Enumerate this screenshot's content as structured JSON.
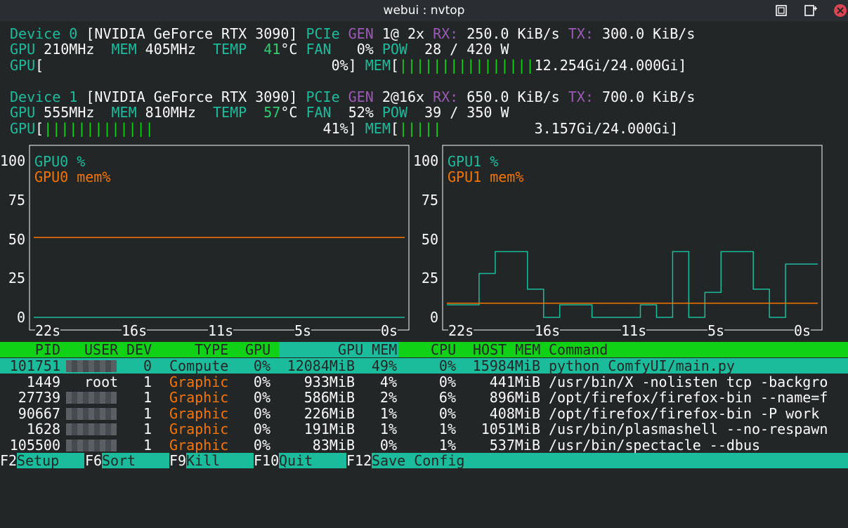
{
  "window": {
    "title": "webui : nvtop",
    "icons": [
      "maximize-icon",
      "pin-icon",
      "close-icon"
    ]
  },
  "devices": [
    {
      "line1": [
        {
          "text": "Device 0 ",
          "c": "t"
        },
        {
          "text": "[NVIDIA GeForce RTX 3090] ",
          "c": "w"
        },
        {
          "text": "PCIe ",
          "c": "t"
        },
        {
          "text": "GEN ",
          "c": "p"
        },
        {
          "text": "1@ 2x ",
          "c": "w"
        },
        {
          "text": "RX: ",
          "c": "p"
        },
        {
          "text": "250.0 KiB/s ",
          "c": "w"
        },
        {
          "text": "TX: ",
          "c": "p"
        },
        {
          "text": "300.0 KiB/s",
          "c": "w"
        }
      ],
      "line2": [
        {
          "text": "GPU ",
          "c": "t"
        },
        {
          "text": "210MHz  ",
          "c": "w"
        },
        {
          "text": "MEM ",
          "c": "t"
        },
        {
          "text": "405MHz  ",
          "c": "w"
        },
        {
          "text": "TEMP  ",
          "c": "t"
        },
        {
          "text": "41",
          "c": "g"
        },
        {
          "text": "°C ",
          "c": "w"
        },
        {
          "text": "FAN   ",
          "c": "t"
        },
        {
          "text": "0% ",
          "c": "w"
        },
        {
          "text": "POW  ",
          "c": "t"
        },
        {
          "text": "28 / 420 W",
          "c": "w"
        }
      ],
      "line3": [
        {
          "text": "GPU",
          "c": "t"
        },
        {
          "text": "[",
          "c": "w"
        },
        {
          "text": "",
          "c": "bar"
        },
        {
          "text": "                                  0%",
          "c": "w"
        },
        {
          "text": "] ",
          "c": "w"
        },
        {
          "text": "MEM",
          "c": "t"
        },
        {
          "text": "[",
          "c": "w"
        },
        {
          "text": "||||||||||||||||",
          "c": "bar"
        },
        {
          "text": "12.254Gi/24.000Gi",
          "c": "w"
        },
        {
          "text": "]",
          "c": "w"
        }
      ]
    },
    {
      "line1": [
        {
          "text": "Device 1 ",
          "c": "t"
        },
        {
          "text": "[NVIDIA GeForce RTX 3090] ",
          "c": "w"
        },
        {
          "text": "PCIe ",
          "c": "t"
        },
        {
          "text": "GEN ",
          "c": "p"
        },
        {
          "text": "2@16x ",
          "c": "w"
        },
        {
          "text": "RX: ",
          "c": "p"
        },
        {
          "text": "650.0 KiB/s ",
          "c": "w"
        },
        {
          "text": "TX: ",
          "c": "p"
        },
        {
          "text": "700.0 KiB/s",
          "c": "w"
        }
      ],
      "line2": [
        {
          "text": "GPU ",
          "c": "t"
        },
        {
          "text": "555MHz  ",
          "c": "w"
        },
        {
          "text": "MEM ",
          "c": "t"
        },
        {
          "text": "810MHz  ",
          "c": "w"
        },
        {
          "text": "TEMP  ",
          "c": "t"
        },
        {
          "text": "57",
          "c": "g"
        },
        {
          "text": "°C ",
          "c": "w"
        },
        {
          "text": "FAN  ",
          "c": "t"
        },
        {
          "text": "52% ",
          "c": "w"
        },
        {
          "text": "POW  ",
          "c": "t"
        },
        {
          "text": "39 / 350 W",
          "c": "w"
        }
      ],
      "line3": [
        {
          "text": "GPU",
          "c": "t"
        },
        {
          "text": "[",
          "c": "w"
        },
        {
          "text": "|||||||||||||",
          "c": "bar"
        },
        {
          "text": "                    41%",
          "c": "w"
        },
        {
          "text": "] ",
          "c": "w"
        },
        {
          "text": "MEM",
          "c": "t"
        },
        {
          "text": "[",
          "c": "w"
        },
        {
          "text": "|||||",
          "c": "bar"
        },
        {
          "text": "           3.157Gi/24.000Gi",
          "c": "w"
        },
        {
          "text": "]",
          "c": "w"
        }
      ]
    }
  ],
  "chart_data": [
    {
      "type": "line",
      "legend": [
        "GPU0 %",
        "GPU0 mem%"
      ],
      "yticks": [
        "100",
        "75",
        "50",
        "25",
        "0"
      ],
      "xticks": [
        "22s",
        "16s",
        "11s",
        "5s",
        "0s"
      ],
      "ylim": [
        0,
        100
      ],
      "x": [
        -23,
        -22,
        -21,
        -20,
        -19,
        -18,
        -17,
        -16,
        -15,
        -14,
        -13,
        -12,
        -11,
        -10,
        -9,
        -8,
        -7,
        -6,
        -5,
        -4,
        -3,
        -2,
        -1,
        0
      ],
      "series": [
        {
          "name": "GPU0 %",
          "color": "#1abc9c",
          "values": [
            0,
            0,
            0,
            0,
            0,
            0,
            0,
            0,
            0,
            0,
            0,
            0,
            0,
            0,
            0,
            0,
            0,
            0,
            0,
            0,
            0,
            0,
            0,
            0
          ]
        },
        {
          "name": "GPU0 mem%",
          "color": "#f67400",
          "values": [
            51,
            51,
            51,
            51,
            51,
            51,
            51,
            51,
            51,
            51,
            51,
            51,
            51,
            51,
            51,
            51,
            51,
            51,
            51,
            51,
            51,
            51,
            51,
            51
          ]
        }
      ]
    },
    {
      "type": "line",
      "legend": [
        "GPU1 %",
        "GPU1 mem%"
      ],
      "yticks": [
        "100",
        "75",
        "50",
        "25",
        "0"
      ],
      "xticks": [
        "22s",
        "16s",
        "11s",
        "5s",
        "0s"
      ],
      "ylim": [
        0,
        100
      ],
      "x": [
        -23,
        -22,
        -21,
        -20,
        -19,
        -18,
        -17,
        -16,
        -15,
        -14,
        -13,
        -12,
        -11,
        -10,
        -9,
        -8,
        -7,
        -6,
        -5,
        -4,
        -3,
        -2,
        -1,
        0
      ],
      "series": [
        {
          "name": "GPU1 %",
          "color": "#1abc9c",
          "values": [
            8,
            8,
            28,
            42,
            42,
            18,
            0,
            8,
            8,
            0,
            0,
            0,
            8,
            0,
            42,
            0,
            16,
            42,
            42,
            18,
            0,
            34,
            34,
            34
          ]
        },
        {
          "name": "GPU1 mem%",
          "color": "#f67400",
          "values": [
            9,
            9,
            9,
            9,
            9,
            9,
            9,
            9,
            9,
            9,
            9,
            9,
            9,
            9,
            9,
            9,
            9,
            9,
            9,
            9,
            9,
            9,
            9,
            9
          ]
        }
      ]
    }
  ],
  "process_table": {
    "headers": {
      "pid": "PID",
      "user": "USER",
      "dev": "DEV",
      "type": "TYPE",
      "gpu": "GPU",
      "gpumem": "GPU MEM",
      "cpu": "CPU",
      "hostmem": "HOST MEM",
      "cmd": "Command"
    },
    "rows": [
      {
        "pid": "101751",
        "user": "",
        "dev": "0",
        "type": "Compute",
        "gpu": "0%",
        "gpumem": "12084MiB",
        "mempct": "49%",
        "cpu": "0%",
        "hostmem": "15984MiB",
        "cmd": "python ComfyUI/main.py",
        "selected": true
      },
      {
        "pid": "1449",
        "user": "root",
        "dev": "1",
        "type": "Graphic",
        "gpu": "0%",
        "gpumem": "933MiB",
        "mempct": "4%",
        "cpu": "0%",
        "hostmem": "441MiB",
        "cmd": "/usr/bin/X -nolisten tcp -backgro",
        "selected": false
      },
      {
        "pid": "27739",
        "user": "",
        "dev": "1",
        "type": "Graphic",
        "gpu": "0%",
        "gpumem": "586MiB",
        "mempct": "2%",
        "cpu": "6%",
        "hostmem": "896MiB",
        "cmd": "/opt/firefox/firefox-bin --name=f",
        "selected": false
      },
      {
        "pid": "90667",
        "user": "",
        "dev": "1",
        "type": "Graphic",
        "gpu": "0%",
        "gpumem": "226MiB",
        "mempct": "1%",
        "cpu": "0%",
        "hostmem": "408MiB",
        "cmd": "/opt/firefox/firefox-bin -P work_",
        "selected": false
      },
      {
        "pid": "1628",
        "user": "",
        "dev": "1",
        "type": "Graphic",
        "gpu": "0%",
        "gpumem": "191MiB",
        "mempct": "1%",
        "cpu": "1%",
        "hostmem": "1051MiB",
        "cmd": "/usr/bin/plasmashell --no-respawn",
        "selected": false
      },
      {
        "pid": "105500",
        "user": "",
        "dev": "1",
        "type": "Graphic",
        "gpu": "0%",
        "gpumem": "83MiB",
        "mempct": "0%",
        "cpu": "1%",
        "hostmem": "537MiB",
        "cmd": "/usr/bin/spectacle --dbus",
        "selected": false
      }
    ]
  },
  "footer": [
    {
      "key": "F2",
      "label": "Setup"
    },
    {
      "key": "F6",
      "label": "Sort"
    },
    {
      "key": "F9",
      "label": "Kill"
    },
    {
      "key": "F10",
      "label": "Quit"
    },
    {
      "key": "F12",
      "label": "Save Config"
    }
  ]
}
